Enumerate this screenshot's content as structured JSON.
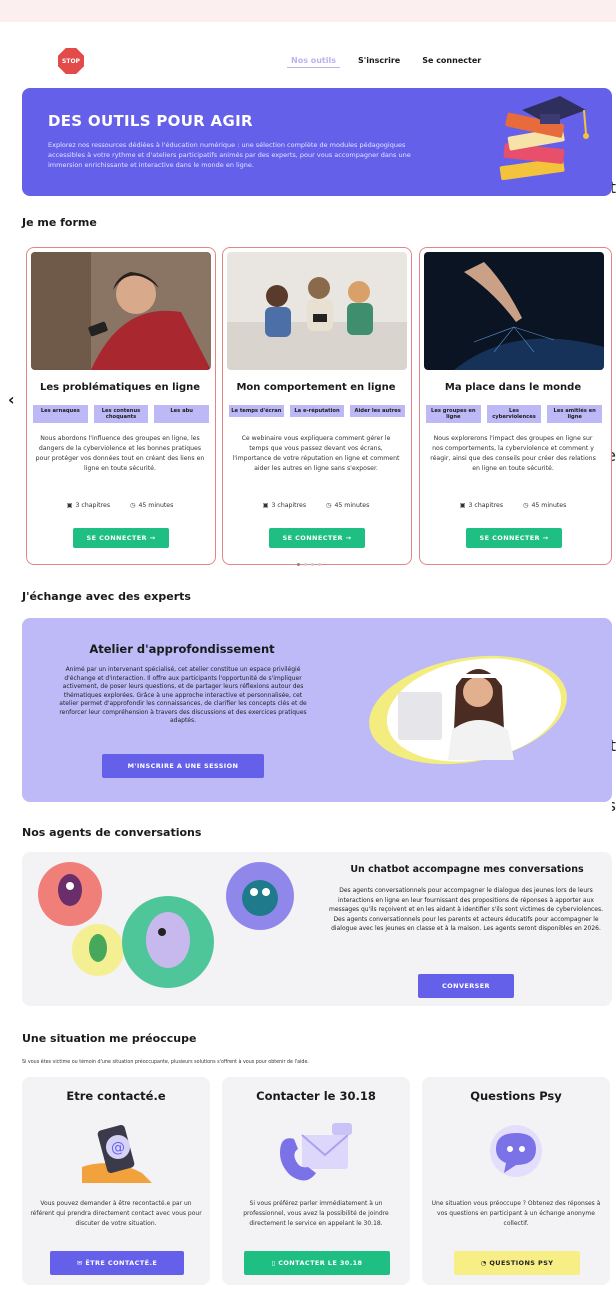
{
  "nav": {
    "logo_text": "STOP",
    "links": [
      "Nos outils",
      "S'inscrire",
      "Se connecter"
    ]
  },
  "hero": {
    "title": "DES OUTILS POUR AGIR",
    "text": "Explorez nos ressources dédiées à l'éducation numérique : une sélection complète de modules pédagogiques accessibles à votre rythme et d'ateliers participatifs animés par des experts, pour vous accompagner dans une immersion enrichissante et interactive dans le monde en ligne."
  },
  "edge_chars": [
    "t",
    "e",
    "t",
    "s"
  ],
  "forme": {
    "heading": "Je me forme",
    "cards": [
      {
        "title": "Les problématiques en ligne",
        "tags": [
          "Les arnaques",
          "Les contenus choquants",
          "Les abu"
        ],
        "text": "Nous abordons l'influence des groupes en ligne, les dangers de la cyberviolence et les bonnes pratiques pour protéger vos données tout en créant des liens en ligne en toute sécurité.",
        "chapters": "3 chapitres",
        "duration": "45 minutes",
        "button": "SE CONNECTER →"
      },
      {
        "title": "Mon comportement en ligne",
        "tags": [
          "Le temps d'écran",
          "La e-réputation",
          "Aider les autres"
        ],
        "text": "Ce webinaire vous expliquera comment gérer le temps que vous passez devant vos écrans, l'importance de votre réputation en ligne et comment aider les autres en ligne sans s'exposer.",
        "chapters": "3 chapitres",
        "duration": "45 minutes",
        "button": "SE CONNECTER →"
      },
      {
        "title": "Ma place dans le monde",
        "tags": [
          "Les groupes en ligne",
          "Les cyberviolences",
          "Les amitiés en ligne"
        ],
        "text": "Nous explorerons l'impact des groupes en ligne sur nos comportements, la cyberviolence et comment y réagir, ainsi que des conseils pour créer des relations en ligne en toute sécurité.",
        "chapters": "3 chapitres",
        "duration": "45 minutes",
        "button": "SE CONNECTER →"
      }
    ]
  },
  "experts": {
    "heading": "J'échange avec des experts",
    "title": "Atelier d'approfondissement",
    "text": "Animé par un intervenant spécialisé, cet atelier constitue un espace privilégié d'échange et d'interaction. Il offre aux participants l'opportunité de s'impliquer activement, de poser leurs questions, et de partager leurs réflexions autour des thématiques explorées. Grâce à une approche interactive et personnalisée, cet atelier permet d'approfondir les connaissances, de clarifier les concepts clés et de renforcer leur compréhension à travers des discussions et des exercices pratiques adaptés.",
    "button": "M'INSCRIRE A UNE SESSION"
  },
  "agents": {
    "heading": "Nos agents de conversations",
    "title": "Un chatbot accompagne mes conversations",
    "text": "Des agents conversationnels pour accompagner le dialogue des jeunes lors de leurs interactions en ligne en leur fournissant des propositions de réponses à apporter aux messages qu'ils reçoivent et en les aidant à identifier s'ils sont victimes de cyberviolences. Des agents conversationnels pour les parents et acteurs éducatifs pour accompagner le dialogue avec les jeunes en classe et à la maison. Les agents seront disponibles en 2026.",
    "button": "CONVERSER"
  },
  "situation": {
    "heading": "Une situation me préoccupe",
    "subtext": "Si vous êtes victime ou témoin d'une situation préoccupante, plusieurs solutions s'offrent à vous pour obtenir de l'aide.",
    "boxes": [
      {
        "title": "Etre contacté.e",
        "text": "Vous pouvez demander à être recontacté.e par un référent qui prendra directement contact avec vous pour discuter de votre situation.",
        "button": "ÊTRE CONTACTÉ.E"
      },
      {
        "title": "Contacter le 30.18",
        "text": "Si vous préférez parler immédiatement à un professionnel, vous avez la possibilité de joindre directement le service en appelant le 30.18.",
        "button": "CONTACTER LE 30.18"
      },
      {
        "title": "Questions Psy",
        "text": "Une situation vous préoccupe ? Obtenez des réponses à vos questions en participant à un échange anonyme collectif.",
        "button": "QUESTIONS PSY"
      }
    ]
  },
  "colors": {
    "purple": "#6560ea",
    "lavender": "#bdbaf7",
    "green": "#1fbf83",
    "yellow": "#f7ee86",
    "card_border": "#e48585"
  }
}
